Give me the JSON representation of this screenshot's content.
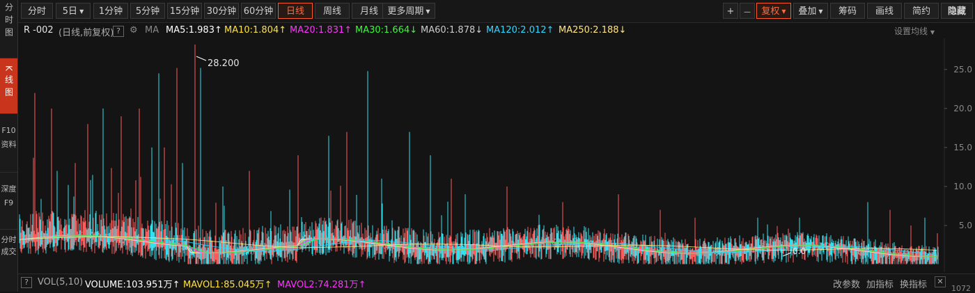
{
  "sidebar": {
    "items": [
      {
        "label": "分时图",
        "active": false
      },
      {
        "label": "K线图",
        "active": true
      },
      {
        "label": "F10资料",
        "active": false
      },
      {
        "label": "深度F9",
        "active": false
      },
      {
        "label": "分时成交",
        "active": false
      }
    ]
  },
  "toolbar": {
    "periods": [
      "分时",
      "5日",
      "1分钟",
      "5分钟",
      "15分钟",
      "30分钟",
      "60分钟",
      "日线",
      "周线",
      "月线",
      "更多周期"
    ],
    "active_period": "日线",
    "zoom_in": "+",
    "zoom_out": "—",
    "right_buttons": [
      "复权",
      "叠加",
      "筹码",
      "画线",
      "简约",
      "隐藏"
    ],
    "active_right": "复权",
    "accent_color": "#ff5a2a"
  },
  "ma_legend": {
    "symbol": "R -002",
    "mode": "(日线,前复权)",
    "help": "?",
    "ma_label": "MA",
    "items": [
      {
        "text": "MA5:1.983",
        "arrow": "↑",
        "color": "#ffffff"
      },
      {
        "text": "MA10:1.804",
        "arrow": "↑",
        "color": "#ffe23b"
      },
      {
        "text": "MA20:1.831",
        "arrow": "↑",
        "color": "#ff33ff"
      },
      {
        "text": "MA30:1.664",
        "arrow": "↓",
        "color": "#33ff33"
      },
      {
        "text": "MA60:1.878",
        "arrow": "↓",
        "color": "#cccccc"
      },
      {
        "text": "MA120:2.012",
        "arrow": "↑",
        "color": "#33d6ff"
      },
      {
        "text": "MA250:2.188",
        "arrow": "↓",
        "color": "#ffe680"
      }
    ],
    "settings": "设置均线"
  },
  "chart_data": {
    "type": "candlestick",
    "ylim": [
      0,
      29
    ],
    "yticks": [
      "25.0",
      "20.0",
      "15.0",
      "10.0",
      "5.0"
    ],
    "max_label": "28.200",
    "min_label": "0.0",
    "up_color": "#ff5b5b",
    "down_color": "#33e1ee",
    "base_level": 2.0
  },
  "volume_bar": {
    "help": "?",
    "label": "VOL(5,10)",
    "volume": "VOLUME:103.951万",
    "volume_arrow": "↑",
    "mavol1": "MAVOL1:85.045万",
    "mavol1_arrow": "↑",
    "mavol2": "MAVOL2:74.281万",
    "mavol2_arrow": "↑",
    "actions": [
      "改参数",
      "加指标",
      "换指标"
    ],
    "bottom_value": "1072",
    "volume_color": "#ffffff",
    "mavol1_color": "#ffe23b",
    "mavol2_color": "#ff33ff"
  }
}
